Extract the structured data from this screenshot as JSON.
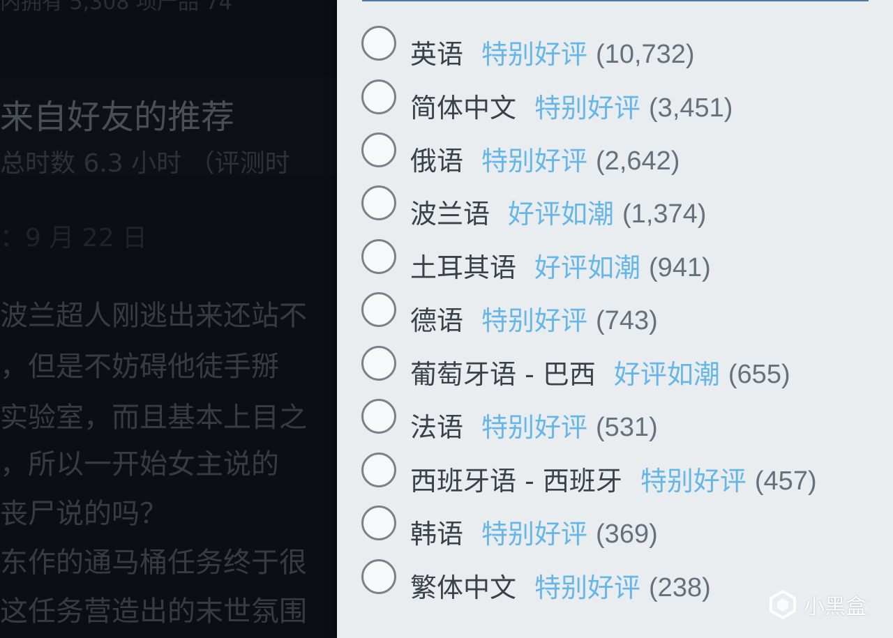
{
  "background": {
    "top_line": "内拥有 5,308 项产品    74",
    "title": "来自好友的推荐",
    "hours": "总时数 6.3 小时 （评测时",
    "date": "：9 月 22 日",
    "body_lines": [
      "波兰超人刚逃出来还站不",
      "，但是不妨碍他徒手掰",
      "实验室，而且基本上目之",
      "，所以一开始女主说的",
      "丧尸说的吗？",
      "东作的通马桶任务终于很",
      "这任务营造出的末世氛围"
    ]
  },
  "language_filter": {
    "options": [
      {
        "language": "英语",
        "rating": "特别好评",
        "count": "(10,732)"
      },
      {
        "language": "简体中文",
        "rating": "特别好评",
        "count": "(3,451)"
      },
      {
        "language": "俄语",
        "rating": "特别好评",
        "count": "(2,642)"
      },
      {
        "language": "波兰语",
        "rating": "好评如潮",
        "count": "(1,374)"
      },
      {
        "language": "土耳其语",
        "rating": "好评如潮",
        "count": "(941)"
      },
      {
        "language": "德语",
        "rating": "特别好评",
        "count": "(743)"
      },
      {
        "language": "葡萄牙语 - 巴西",
        "rating": "好评如潮",
        "count": "(655)"
      },
      {
        "language": "法语",
        "rating": "特别好评",
        "count": "(531)"
      },
      {
        "language": "西班牙语 - 西班牙",
        "rating": "特别好评",
        "count": "(457)"
      },
      {
        "language": "韩语",
        "rating": "特别好评",
        "count": "(369)"
      },
      {
        "language": "繁体中文",
        "rating": "特别好评",
        "count": "(238)"
      }
    ]
  },
  "watermark": {
    "text": "小黑盒",
    "icon": "heybox-logo-icon"
  },
  "colors": {
    "panel_bg": "#e9edf0",
    "rating_blue": "#66b6e6",
    "count_gray": "#65717c",
    "page_bg": "#0b0f14"
  }
}
